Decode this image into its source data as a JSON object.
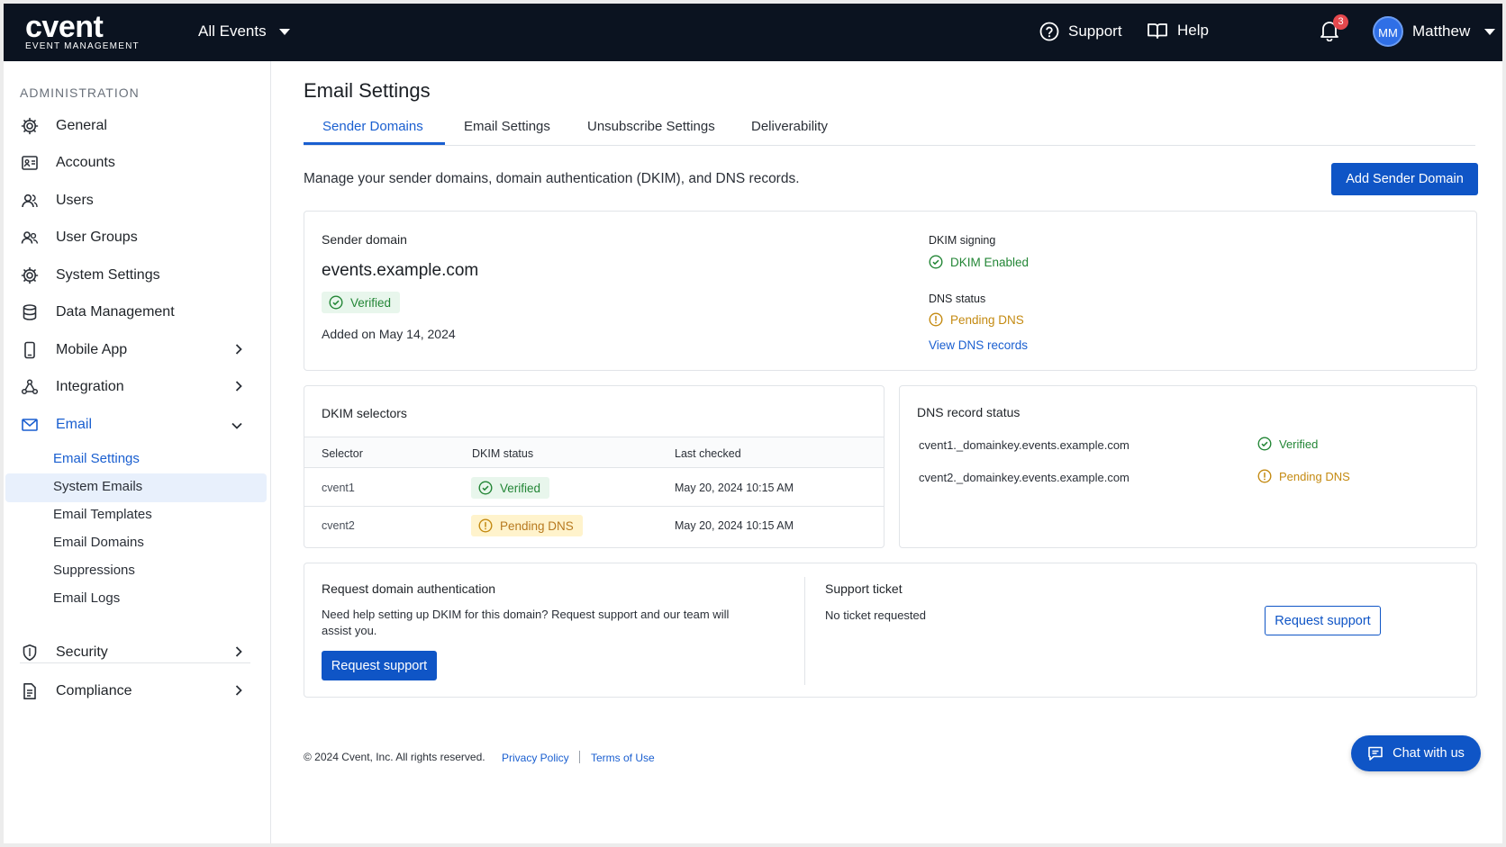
{
  "topbar": {
    "logo_word": "cvent",
    "logo_sub": "EVENT MANAGEMENT",
    "events_label": "All Events",
    "support_label": "Support",
    "help_label": "Help",
    "notification_count": "3",
    "user_initials": "MM",
    "user_name": "Matthew"
  },
  "sidebar": {
    "heading": "ADMINISTRATION",
    "items": [
      {
        "label": "General",
        "icon": "gear-icon"
      },
      {
        "label": "Accounts",
        "icon": "id-card-icon"
      },
      {
        "label": "Users",
        "icon": "user-icon"
      },
      {
        "label": "User Groups",
        "icon": "users-icon"
      },
      {
        "label": "System Settings",
        "icon": "gear-icon"
      },
      {
        "label": "Data Management",
        "icon": "database-icon"
      },
      {
        "label": "Mobile App",
        "icon": "phone-icon"
      },
      {
        "label": "Integration",
        "icon": "integration-icon"
      },
      {
        "label": "Email",
        "icon": "mail-icon"
      },
      {
        "label": "Security",
        "icon": "shield-icon"
      },
      {
        "label": "Compliance",
        "icon": "document-icon"
      }
    ],
    "email_sub": [
      "Email Settings",
      "System Emails",
      "Email Templates",
      "Email Domains",
      "Suppressions",
      "Email Logs"
    ]
  },
  "main": {
    "title": "Email Settings",
    "tabs": [
      "Sender Domains",
      "Email Settings",
      "Unsubscribe Settings",
      "Deliverability"
    ],
    "intro": "Manage your sender domains, domain authentication (DKIM), and DNS records.",
    "add_button": "Add Sender Domain"
  },
  "domain_card": {
    "label": "Sender domain",
    "domain": "events.example.com",
    "verified": "Verified",
    "added": "Added on May 14, 2024",
    "dkim_label": "DKIM signing",
    "dkim_value": "DKIM Enabled",
    "dns_label": "DNS status",
    "dns_value": "Pending DNS",
    "dns_link": "View DNS records"
  },
  "selectors": {
    "title": "DKIM selectors",
    "headers": [
      "Selector",
      "DKIM status",
      "Last checked"
    ],
    "rows": [
      {
        "selector": "cvent1",
        "status": "Verified",
        "checked": "May 20, 2024 10:15 AM"
      },
      {
        "selector": "cvent2",
        "status": "Pending DNS",
        "checked": "May 20, 2024 10:15 AM"
      }
    ]
  },
  "dns_card": {
    "title": "DNS record status",
    "records": [
      {
        "name": "cvent1._domainkey.events.example.com",
        "status": "Verified"
      },
      {
        "name": "cvent2._domainkey.events.example.com",
        "status": "Pending DNS"
      }
    ]
  },
  "auth_card": {
    "title": "Request domain authentication",
    "body": "Need help setting up DKIM for this domain? Request support and our team will assist you.",
    "button": "Request support"
  },
  "ticket_card": {
    "title": "Support ticket",
    "body": "No ticket requested",
    "button": "Request support"
  },
  "footer": {
    "copyright": "© 2024 Cvent, Inc. All rights reserved.",
    "privacy": "Privacy Policy",
    "terms": "Terms of Use"
  },
  "chat": {
    "label": "Chat with us"
  },
  "colors": {
    "brand": "#0f55c6",
    "topbar": "#0b1320",
    "success": "#238636",
    "warning": "#c48a11"
  }
}
